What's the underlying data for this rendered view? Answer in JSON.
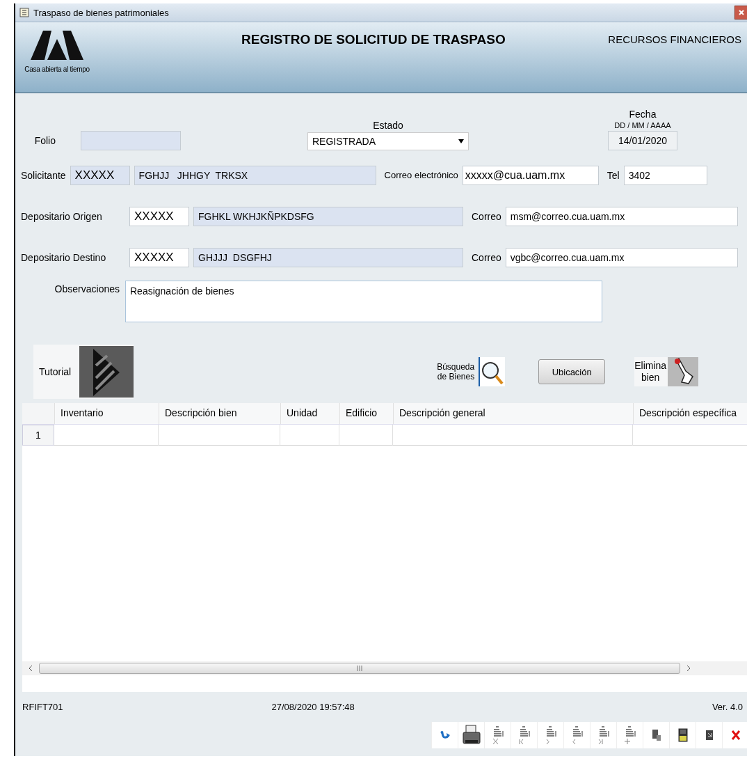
{
  "window": {
    "title": "Traspaso de bienes patrimoniales"
  },
  "header": {
    "logo_caption": "Casa abierta al tiempo",
    "title": "REGISTRO DE SOLICITUD DE TRASPASO",
    "department": "RECURSOS FINANCIEROS"
  },
  "form": {
    "folio": {
      "label": "Folio"
    },
    "estado": {
      "label": "Estado",
      "value": "REGISTRADA"
    },
    "fecha": {
      "label": "Fecha",
      "format": "DD / MM / AAAA",
      "value": "14/01/2020"
    },
    "people": [
      {
        "label": "Solicitante",
        "code": "XXXXX",
        "name": "FGHJJ   JHHGY  TRKSX",
        "email_label": "Correo electrónico",
        "email": "xxxxx@cua.uam.mx",
        "phone_label": "Tel",
        "phone": "3402"
      },
      {
        "label": "Depositario Origen",
        "code": "XXXXX",
        "name": "FGHKL WKHJKÑPKDSFG",
        "email_label": "Correo",
        "email": "msm@correo.cua.uam.mx"
      },
      {
        "label": "Depositario Destino",
        "code": "XXXXX",
        "name": "GHJJJ  DSGFHJ",
        "email_label": "Correo",
        "email": "vgbc@correo.cua.uam.mx"
      }
    ],
    "observaciones": {
      "label": "Observaciones",
      "value": "Reasignación de bienes"
    }
  },
  "actions": [
    {
      "kind": "tutorial",
      "label": "Tutorial"
    },
    {
      "kind": "search",
      "label": "Búsqueda de Bienes"
    },
    {
      "kind": "button",
      "label": "Ubicación"
    },
    {
      "kind": "delete",
      "label": "Elimina bien"
    }
  ],
  "table": {
    "columns": [
      "Inventario",
      "Descripción bien",
      "Unidad",
      "Edificio",
      "Descripción general",
      "Descripción específica"
    ],
    "rows": [
      {
        "number": "1"
      }
    ]
  },
  "footer": {
    "code": "RFIFT701",
    "timestamp": "27/08/2020 19:57:48",
    "version": "Ver. 4.0"
  },
  "toolbar": [
    {
      "kind": "refresh"
    },
    {
      "kind": "print"
    },
    {
      "kind": "delete"
    },
    {
      "kind": "first"
    },
    {
      "kind": "next"
    },
    {
      "kind": "prev"
    },
    {
      "kind": "last"
    },
    {
      "kind": "add"
    },
    {
      "kind": "copy"
    },
    {
      "kind": "save"
    },
    {
      "kind": "exit"
    },
    {
      "kind": "close"
    }
  ]
}
